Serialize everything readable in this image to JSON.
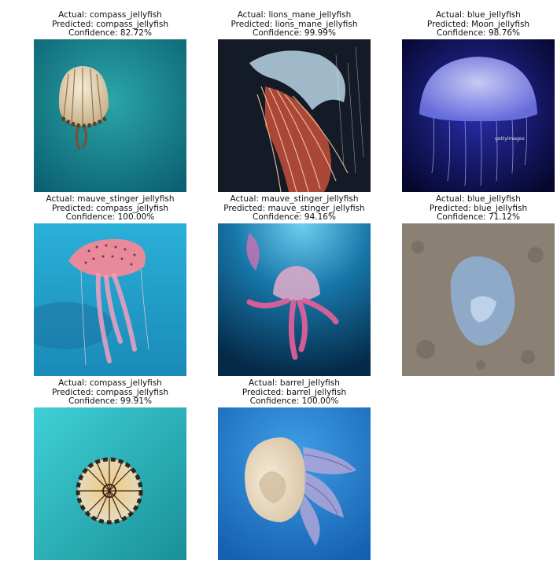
{
  "panels": [
    {
      "actual": "Actual: compass_jellyfish",
      "predicted": "Predicted: compass_jellyfish",
      "confidence": "Confidence: 82.72%"
    },
    {
      "actual": "Actual: lions_mane_jellyfish",
      "predicted": "Predicted: lions_mane_jellyfish",
      "confidence": "Confidence: 99.99%"
    },
    {
      "actual": "Actual: blue_jellyfish",
      "predicted": "Predicted: Moon_jellyfish",
      "confidence": "Confidence: 98.76%",
      "watermark": "gettyimages"
    },
    {
      "actual": "Actual: mauve_stinger_jellyfish",
      "predicted": "Predicted: compass_jellyfish",
      "confidence": "Confidence: 100.00%"
    },
    {
      "actual": "Actual: mauve_stinger_jellyfish",
      "predicted": "Predicted: mauve_stinger_jellyfish",
      "confidence": "Confidence: 94.16%"
    },
    {
      "actual": "Actual: blue_jellyfish",
      "predicted": "Predicted: blue_jellyfish",
      "confidence": "Confidence: 71.12%"
    },
    {
      "actual": "Actual: compass_jellyfish",
      "predicted": "Predicted: compass_jellyfish",
      "confidence": "Confidence: 99.91%"
    },
    {
      "actual": "Actual: barrel_jellyfish",
      "predicted": "Predicted: barrel_jellyfish",
      "confidence": "Confidence: 100.00%"
    }
  ]
}
